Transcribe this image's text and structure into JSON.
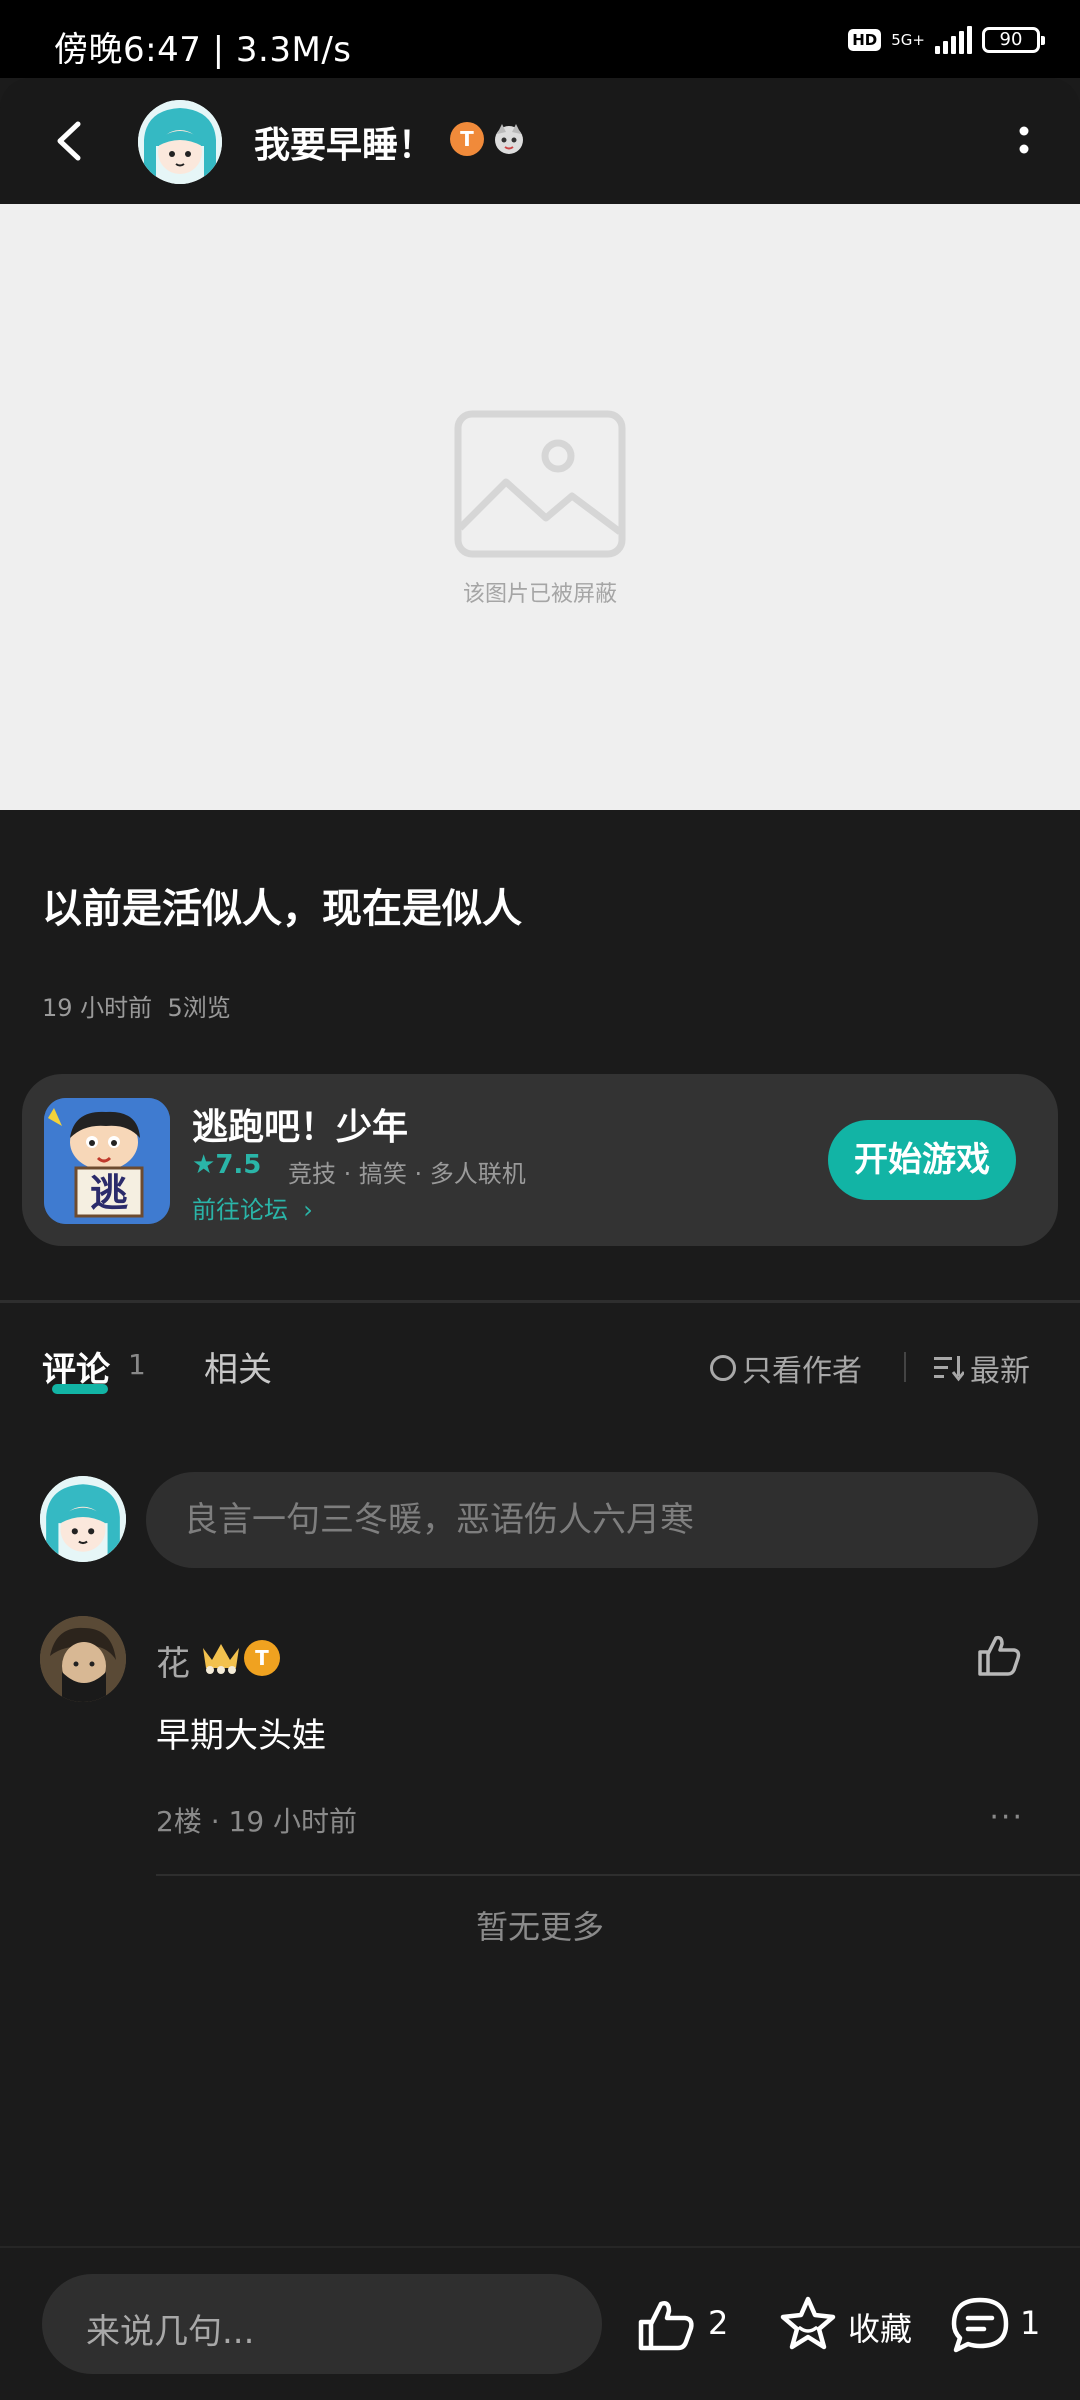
{
  "status_bar": {
    "time_speed": "傍晚6:47 | 3.3M/s",
    "hd": "HD",
    "network": "5G+",
    "battery": "90"
  },
  "header": {
    "title": "我要早睡！",
    "badge_letter": "T",
    "icons": [
      "back-arrow-icon",
      "avatar",
      "level-badge-icon",
      "character-badge-icon",
      "more-vertical-icon"
    ]
  },
  "image": {
    "blocked_caption": "该图片已被屏蔽",
    "icon": "image-placeholder-icon",
    "background": "#efefef"
  },
  "post": {
    "title": "以前是活似人，现在是似人",
    "time": "19 小时前",
    "views": "5浏览"
  },
  "game_card": {
    "name": "逃跑吧！少年",
    "rating": "7.5",
    "tags": "竞技 · 搞笑 · 多人联机",
    "forum_link": "前往论坛",
    "play_button": "开始游戏",
    "icon_text": "逃",
    "accent": "#12b4a5"
  },
  "tabs": {
    "comments_label": "评论",
    "comments_count": "1",
    "related_label": "相关",
    "author_only": "只看作者",
    "sort": "最新"
  },
  "comment_input": {
    "placeholder": "良言一句三冬暖，恶语伤人六月寒"
  },
  "comments": [
    {
      "user": "花",
      "badge_letter": "T",
      "text": "早期大头娃",
      "meta": "2楼 · 19 小时前",
      "more": "···"
    }
  ],
  "no_more": "暂无更多",
  "bottom_bar": {
    "input_placeholder": "来说几句...",
    "like_count": "2",
    "favorite_label": "收藏",
    "comment_count": "1"
  }
}
